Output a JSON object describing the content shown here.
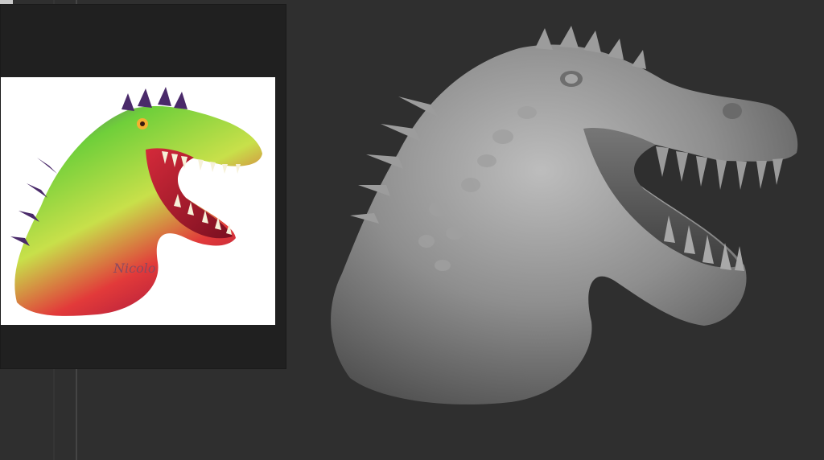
{
  "app": {
    "canvas_background": "#2f2f2f",
    "panel_background": "#202020"
  },
  "reference_panel": {
    "image_description_icon": "dinosaur-painting",
    "signature_text": "Nicolo"
  },
  "viewport": {
    "model_icon": "dinosaur-head-sculpt",
    "model_color": "#8c8c8c"
  }
}
